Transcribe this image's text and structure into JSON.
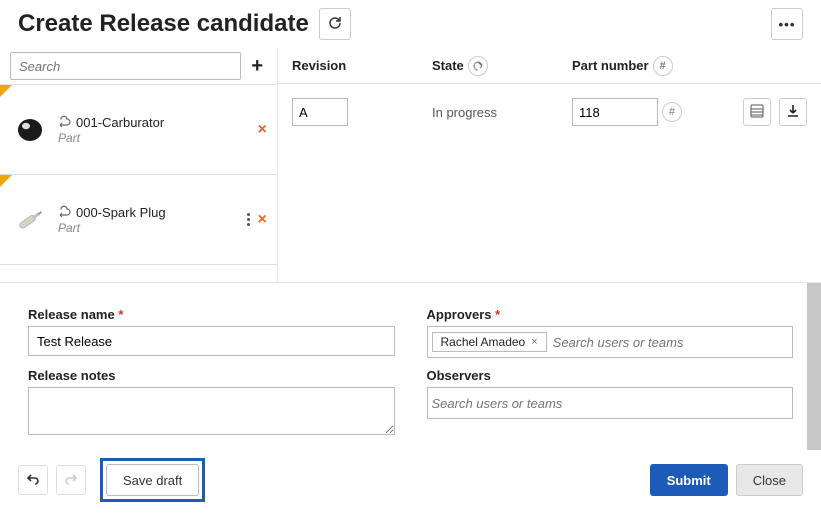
{
  "header": {
    "title": "Create Release candidate"
  },
  "search": {
    "placeholder": "Search"
  },
  "parts": [
    {
      "name": "001-Carburator",
      "type": "Part"
    },
    {
      "name": "000-Spark Plug",
      "type": "Part"
    }
  ],
  "columns": {
    "revision": "Revision",
    "state": "State",
    "part_number": "Part number"
  },
  "row": {
    "revision_value": "A",
    "state_value": "In progress",
    "part_number_value": "118"
  },
  "form": {
    "release_name_label": "Release name",
    "release_name_value": "Test Release",
    "release_notes_label": "Release notes",
    "approvers_label": "Approvers",
    "approvers_placeholder": "Search users or teams",
    "observers_label": "Observers",
    "observers_placeholder": "Search users or teams",
    "approver_tag": "Rachel Amadeo"
  },
  "buttons": {
    "save_draft": "Save draft",
    "submit": "Submit",
    "close": "Close"
  },
  "symbols": {
    "hash": "#",
    "times": "×",
    "ellipsis": "•••",
    "x_tag": "×"
  }
}
